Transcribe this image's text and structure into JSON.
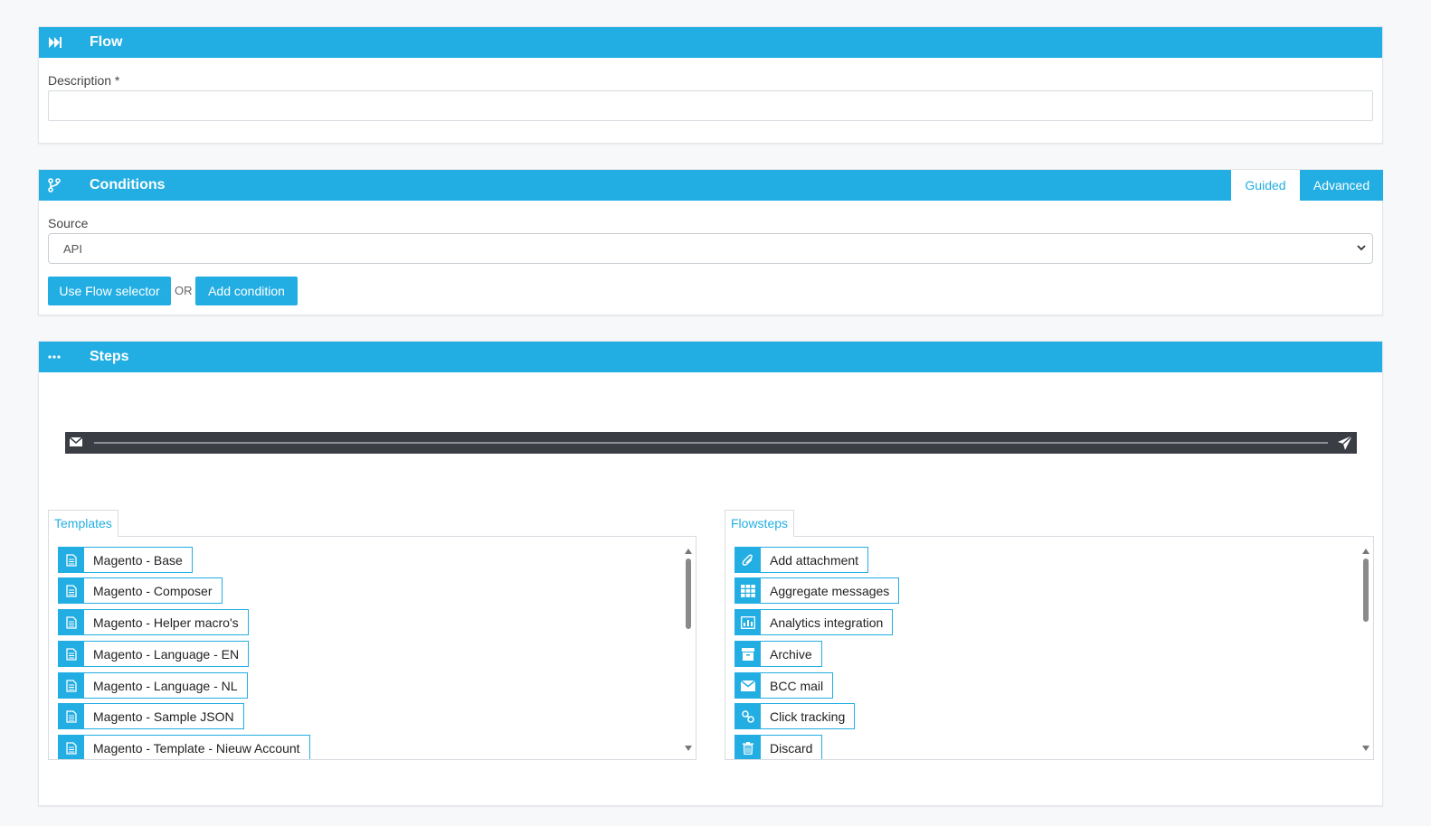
{
  "flow": {
    "title": "Flow",
    "description_label": "Description *",
    "description_value": ""
  },
  "conditions": {
    "title": "Conditions",
    "tab_guided": "Guided",
    "tab_advanced": "Advanced",
    "source_label": "Source",
    "source_value": "API",
    "use_flow_selector": "Use Flow selector",
    "or_text": "OR",
    "add_condition": "Add condition"
  },
  "steps": {
    "title": "Steps",
    "templates_tab": "Templates",
    "flowsteps_tab": "Flowsteps",
    "templates": [
      {
        "label": "Magento - Base",
        "icon": "document-icon"
      },
      {
        "label": "Magento - Composer",
        "icon": "document-icon"
      },
      {
        "label": "Magento - Helper macro's",
        "icon": "document-icon"
      },
      {
        "label": "Magento - Language - EN",
        "icon": "document-icon"
      },
      {
        "label": "Magento - Language - NL",
        "icon": "document-icon"
      },
      {
        "label": "Magento - Sample JSON",
        "icon": "document-icon"
      },
      {
        "label": "Magento - Template - Nieuw Account",
        "icon": "document-icon"
      }
    ],
    "flowsteps": [
      {
        "label": "Add attachment",
        "icon": "paperclip-icon"
      },
      {
        "label": "Aggregate messages",
        "icon": "grid-icon"
      },
      {
        "label": "Analytics integration",
        "icon": "bar-chart-icon"
      },
      {
        "label": "Archive",
        "icon": "archive-icon"
      },
      {
        "label": "BCC mail",
        "icon": "envelope-icon"
      },
      {
        "label": "Click tracking",
        "icon": "link-icon"
      },
      {
        "label": "Discard",
        "icon": "trash-icon"
      }
    ]
  },
  "colors": {
    "accent": "#23aee3",
    "timeline": "#3a3d44",
    "background": "#f7f8fa"
  }
}
